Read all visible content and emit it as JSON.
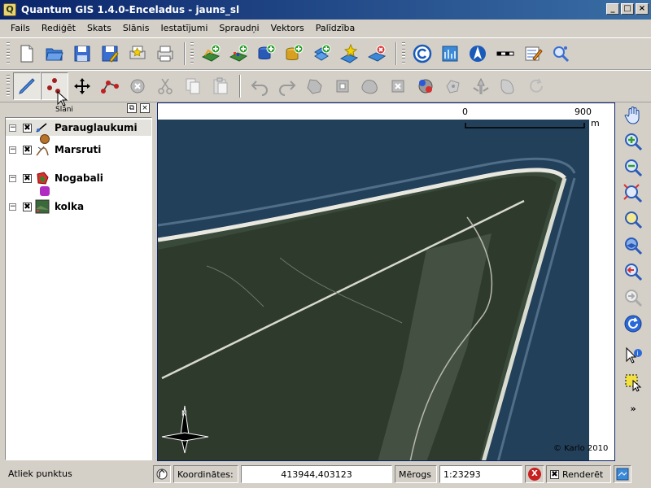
{
  "window": {
    "title": "Quantum GIS 1.4.0-Enceladus - jauns_sl",
    "app_icon": "Q"
  },
  "window_buttons": {
    "minimize": "_",
    "maximize": "□",
    "close": "×"
  },
  "menu": [
    "Fails",
    "Rediģēt",
    "Skats",
    "Slānis",
    "Iestatījumi",
    "Spraudņi",
    "Vektors",
    "Palīdzība"
  ],
  "toolbar_icons": {
    "row1": [
      "new-project-icon",
      "open-project-icon",
      "save-project-icon",
      "save-as-icon",
      "print-composer-icon",
      "print-icon",
      "add-vector-layer-icon",
      "add-raster-layer-icon",
      "add-postgis-layer-icon",
      "add-spatialite-layer-icon",
      "add-wms-layer-icon",
      "new-shapefile-icon",
      "remove-layer-icon",
      "copyright-icon",
      "georeferencer-icon",
      "north-arrow-icon",
      "scale-bar-icon",
      "edit-notes-icon",
      "plugin-search-icon"
    ],
    "row2": [
      "toggle-editing-icon",
      "capture-point-icon",
      "move-feature-icon",
      "node-tool-icon",
      "delete-selected-icon",
      "cut-features-icon",
      "copy-features-icon",
      "paste-features-icon",
      "undo-icon",
      "redo-icon",
      "simplify-feature-icon",
      "add-ring-icon",
      "add-island-icon",
      "delete-ring-icon",
      "delete-part-icon",
      "reshape-icon",
      "split-features-icon",
      "merge-features-icon",
      "rotate-symbols-icon",
      "rotate-icon"
    ]
  },
  "layers_panel": {
    "title": "Slāni",
    "float_btn": "⧉",
    "close_btn": "×",
    "layers": [
      {
        "name": "Parauglaukumi",
        "checked": "✖",
        "expander": "−",
        "selected": true,
        "icon": "point-layer-icon",
        "legend_color": "#b8722a"
      },
      {
        "name": "Marsruti",
        "checked": "✖",
        "expander": "−",
        "selected": false,
        "icon": "line-layer-icon",
        "legend_color": "#8a5a2a"
      },
      {
        "name": "Nogabali",
        "checked": "✖",
        "expander": "−",
        "selected": false,
        "icon": "polygon-layer-icon",
        "legend_color": "#b02cc2"
      },
      {
        "name": "kolka",
        "checked": "✖",
        "expander": "−",
        "selected": false,
        "icon": "raster-layer-icon",
        "legend_color": "#3a6a3a"
      }
    ]
  },
  "map": {
    "scale_left": "0",
    "scale_right": "900",
    "scale_unit": "m",
    "copyright": "© Karlo 2010",
    "north_label": "N"
  },
  "right_toolbar": [
    "pan-icon",
    "zoom-in-icon",
    "zoom-out-icon",
    "zoom-full-icon",
    "zoom-to-selection-icon",
    "zoom-to-layer-icon",
    "zoom-last-icon",
    "zoom-next-icon",
    "refresh-icon",
    "identify-icon",
    "select-features-icon"
  ],
  "right_toolbar_more": "»",
  "statusbar": {
    "message": "Atliek punktus",
    "coord_label": "Koordinātes:",
    "coord_value": "413944,403123",
    "scale_label": "Mērogs",
    "scale_value": "1:23293",
    "stop_btn": "X",
    "render_check": "✖",
    "render_label": "Renderēt"
  }
}
